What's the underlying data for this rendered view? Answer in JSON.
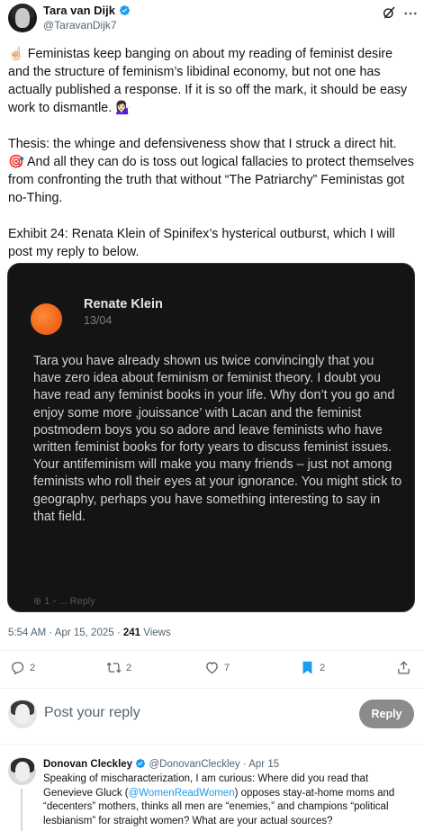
{
  "author": {
    "display_name": "Tara van Dijk",
    "handle": "@TaravanDijk7"
  },
  "tweet": {
    "paragraph_1": "☝🏻 Feministas keep banging on about my reading of feminist desire and the structure of feminism’s libidinal economy, but not one has actually published a response. If it is so off the mark, it should be easy work to dismantle. 💁🏻‍♀️",
    "paragraph_2": "Thesis: the whinge and defensiveness show that I struck a direct hit. 🎯 And all they can do is toss out logical fallacies to protect themselves from confronting the truth that without “The Patriarchy” Feministas got no-Thing.",
    "paragraph_3": "Exhibit 24: Renata Klein of Spinifex’s hysterical outburst, which I will post my reply to below."
  },
  "embedded": {
    "name": "Renate Klein",
    "date": "13/04",
    "text": "Tara you have already shown us twice convincingly that you have zero idea about feminism or feminist theory. I doubt you have read any feminist books in your life. Why don’t you go and enjoy some more ‚jouissance’ with Lacan and the feminist postmodern boys you so adore and leave feminists who have written feminist books for forty years to discuss feminist issues. Your antifeminism will make you many friends – just not among feminists who roll their eyes at your ignorance. You might stick to geography, perhaps you have something interesting to say in that field.",
    "fade_text": "⊕ 1 ◦ ... Reply"
  },
  "meta": {
    "timestamp": "5:54 AM · Apr 15, 2025 · ",
    "views_count": "241",
    "views_label": " Views"
  },
  "actions": {
    "replies": "2",
    "reposts": "2",
    "likes": "7",
    "bookmarks": "2"
  },
  "reply_composer": {
    "placeholder": "Post your reply",
    "button_label": "Reply"
  },
  "reply": {
    "display_name": "Donovan Cleckley",
    "handle_date": "@DonovanCleckley · Apr 15",
    "text_before": "Speaking of mischaracterization, I am curious: Where did you read that Genevieve Gluck (",
    "mention": "@WomenReadWomen",
    "text_after": ") opposes stay-at-home moms and “decenters” mothers, thinks all men are “enemies,” and champions “political lesbianism” for straight women? What are your actual sources?"
  },
  "colors": {
    "accent": "#1d9bf0",
    "bookmark_active": "#1d9bf0",
    "secondary_text": "#536471",
    "reply_button": "#8b8b8b",
    "embedded_bg": "#141414",
    "embedded_avatar": "#f26a1b"
  },
  "icons": {
    "verified": "verified-badge-icon",
    "grok": "grok-icon",
    "more": "more-icon",
    "reply": "reply-icon",
    "repost": "repost-icon",
    "like": "heart-icon",
    "bookmark": "bookmark-icon",
    "share": "share-icon"
  }
}
